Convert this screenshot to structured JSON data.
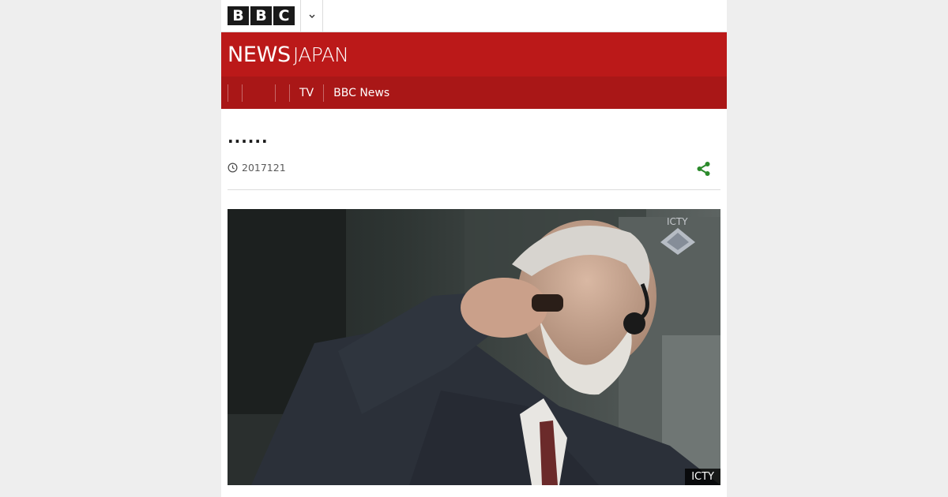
{
  "header": {
    "logo_letters": [
      "B",
      "B",
      "C"
    ],
    "more_icon": "chevron-down-icon"
  },
  "masthead": {
    "brand_news": "NEWS",
    "brand_region": "JAPAN"
  },
  "nav": {
    "items": [
      {
        "label": ""
      },
      {
        "label": ""
      },
      {
        "label": "TV"
      },
      {
        "label": "BBC News"
      }
    ]
  },
  "article": {
    "headline": "......",
    "date": "2017121",
    "clock_icon": "clock-icon",
    "share_icon": "share-icon",
    "image": {
      "description_icon": "photo",
      "credit": "ICTY",
      "watermark": "ICTY"
    }
  },
  "colors": {
    "masthead": "#bb1919",
    "nav": "#a91717",
    "share": "#2b8a2b",
    "page_bg": "#eeeeee"
  }
}
